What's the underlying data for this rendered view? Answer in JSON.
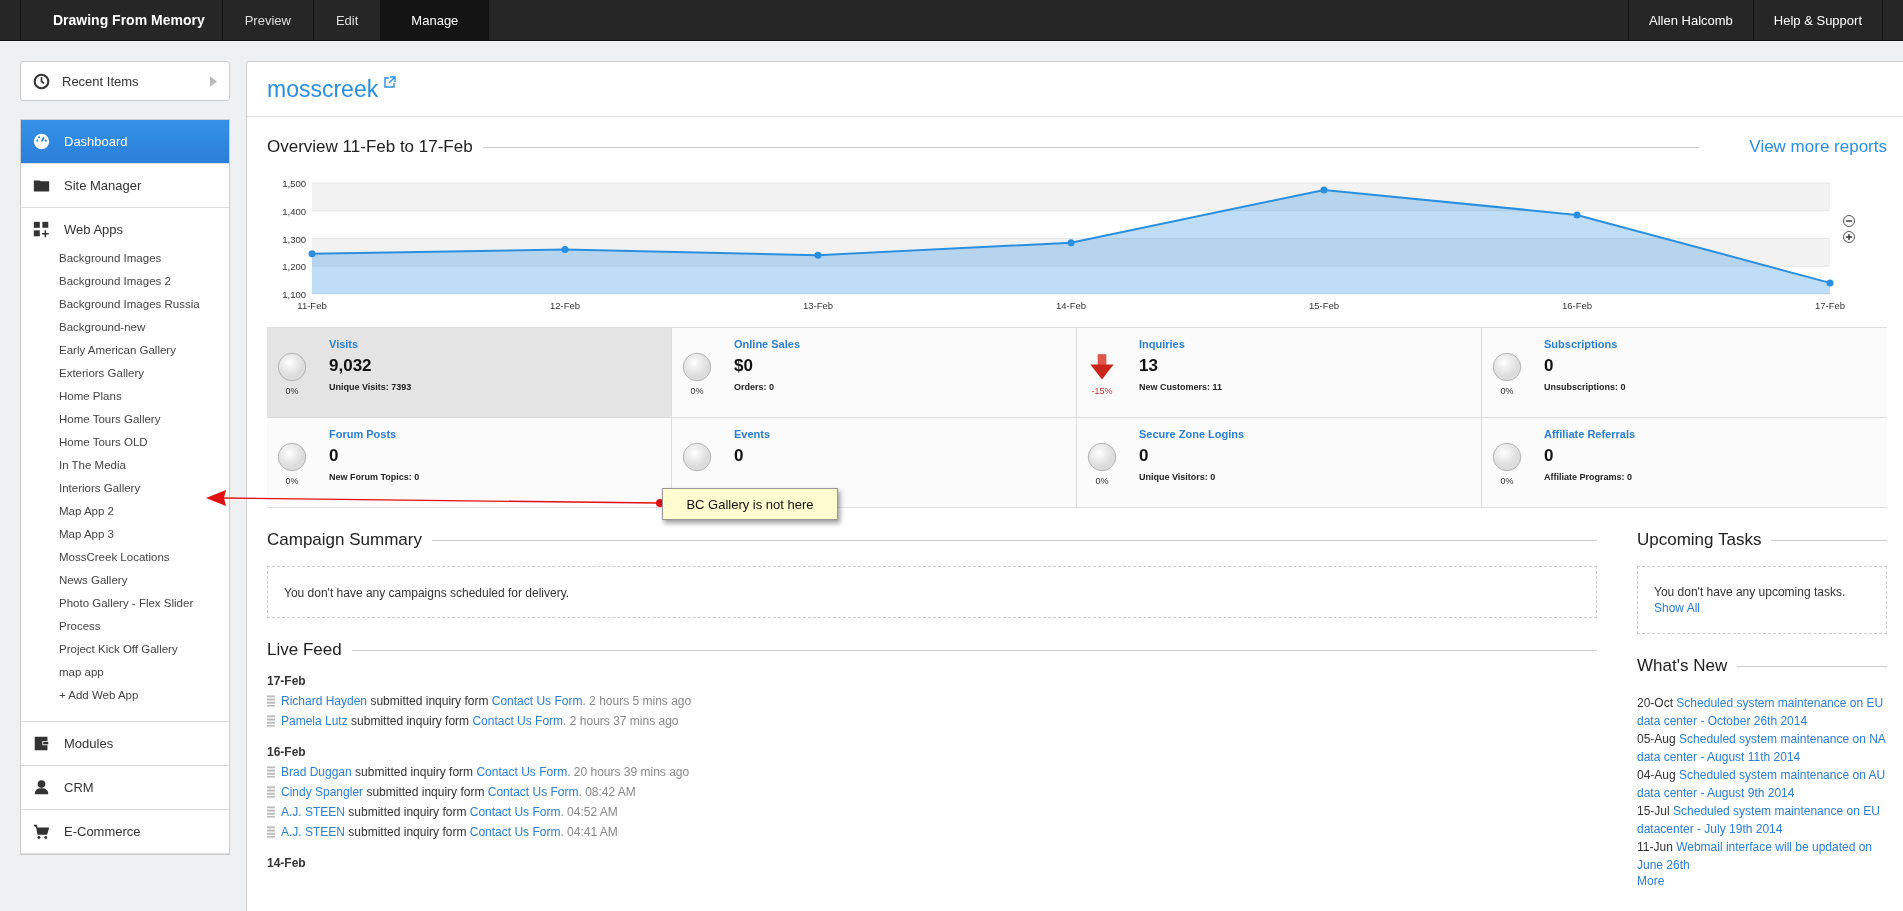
{
  "topbar": {
    "brand": "Drawing From Memory",
    "tabs": [
      {
        "label": "Preview",
        "selected": false
      },
      {
        "label": "Edit",
        "selected": false
      },
      {
        "label": "Manage",
        "selected": true
      }
    ],
    "right_links": [
      "Allen Halcomb",
      "Help & Support"
    ]
  },
  "sidebar": {
    "recent": "Recent Items",
    "items": [
      {
        "label": "Dashboard",
        "selected": true
      },
      {
        "label": "Site Manager",
        "selected": false
      },
      {
        "label": "Web Apps",
        "selected": false,
        "expanded": true,
        "children": [
          {
            "label": "Background Images"
          },
          {
            "label": "Background Images 2"
          },
          {
            "label": "Background Images Russia"
          },
          {
            "label": "Background-new"
          },
          {
            "label": "Early American Gallery"
          },
          {
            "label": "Exteriors Gallery"
          },
          {
            "label": "Home Plans"
          },
          {
            "label": "Home Tours Gallery"
          },
          {
            "label": "Home Tours OLD"
          },
          {
            "label": "In The Media"
          },
          {
            "label": "Interiors Gallery"
          },
          {
            "label": "Map App 2"
          },
          {
            "label": "Map App 3"
          },
          {
            "label": "MossCreek Locations"
          },
          {
            "label": "News Gallery"
          },
          {
            "label": "Photo Gallery - Flex Slider"
          },
          {
            "label": "Process"
          },
          {
            "label": "Project Kick Off Gallery"
          },
          {
            "label": "map app"
          }
        ],
        "add_link": "+ Add Web App"
      },
      {
        "label": "Modules",
        "selected": false
      },
      {
        "label": "CRM",
        "selected": false
      },
      {
        "label": "E-Commerce",
        "selected": false
      }
    ]
  },
  "site": {
    "name": "mosscreek"
  },
  "overview": {
    "title": "Overview 11-Feb to 17-Feb",
    "link": "View more reports",
    "chart_data": {
      "type": "area",
      "categories": [
        "11-Feb",
        "12-Feb",
        "13-Feb",
        "14-Feb",
        "15-Feb",
        "16-Feb",
        "17-Feb"
      ],
      "grid": true,
      "series": [
        {
          "color": "#2b8fe0",
          "values": [
            1245,
            1260,
            1240,
            1285,
            1475,
            1385,
            1140
          ]
        }
      ],
      "ylim": [
        1100,
        1500
      ],
      "yticks": [
        {
          "value": 1100,
          "label": "1,100"
        },
        {
          "value": 1200,
          "label": "1,200"
        },
        {
          "value": 1300,
          "label": "1,300"
        },
        {
          "value": 1400,
          "label": "1,400"
        },
        {
          "value": 1500,
          "label": "1,500"
        }
      ]
    }
  },
  "stats": [
    {
      "title": "Visits",
      "value": "9,032",
      "kind": "circle",
      "percent": "0%",
      "sub": "Unique Visits: 7393",
      "selected": true
    },
    {
      "title": "Online Sales",
      "value": "$0",
      "kind": "circle",
      "percent": "0%",
      "sub": "Orders: 0",
      "selected": false
    },
    {
      "title": "Inquiries",
      "value": "13",
      "kind": "down",
      "percent": "-15%",
      "sub": "New Customers: 11",
      "selected": false
    },
    {
      "title": "Subscriptions",
      "value": "0",
      "kind": "circle",
      "percent": "0%",
      "sub": "Unsubscriptions: 0",
      "selected": false
    },
    {
      "title": "Forum Posts",
      "value": "0",
      "kind": "circle",
      "percent": "0%",
      "sub": "New Forum Topics: 0",
      "selected": false
    },
    {
      "title": "Events",
      "value": "0",
      "kind": "circle",
      "selected": false
    },
    {
      "title": "Secure Zone Logins",
      "value": "0",
      "kind": "circle",
      "percent": "0%",
      "sub": "Unique Visitors: 0",
      "selected": false
    },
    {
      "title": "Affiliate Referrals",
      "value": "0",
      "kind": "circle",
      "percent": "0%",
      "sub": "Affiliate Programs: 0",
      "selected": false
    }
  ],
  "callout": {
    "text": "BC Gallery is not here"
  },
  "campaign": {
    "title": "Campaign Summary",
    "empty": "You don't have any campaigns scheduled for delivery."
  },
  "live_feed": {
    "title": "Live Feed",
    "groups": [
      {
        "date": "17-Feb",
        "entries": [
          {
            "name": "Richard Hayden",
            "action": "submitted inquiry form",
            "form": "Contact Us Form",
            "time": ". 2 hours 5 mins ago"
          },
          {
            "name": "Pamela Lutz",
            "action": "submitted inquiry form",
            "form": "Contact Us Form",
            "time": ". 2 hours 37 mins ago"
          }
        ]
      },
      {
        "date": "16-Feb",
        "entries": [
          {
            "name": "Brad Duggan",
            "action": "submitted inquiry form",
            "form": "Contact Us Form",
            "time": ". 20 hours 39 mins ago"
          },
          {
            "name": "Cindy Spangler",
            "action": "submitted inquiry form",
            "form": "Contact Us Form",
            "time": ". 08:42 AM"
          },
          {
            "name": "A.J. STEEN",
            "action": "submitted inquiry form",
            "form": "Contact Us Form",
            "time": ". 04:52 AM"
          },
          {
            "name": "A.J. STEEN",
            "action": "submitted inquiry form",
            "form": "Contact Us Form",
            "time": ". 04:41 AM"
          }
        ]
      },
      {
        "date": "14-Feb"
      }
    ]
  },
  "tasks": {
    "title": "Upcoming Tasks",
    "empty": "You don't have any upcoming tasks.",
    "link": "Show All"
  },
  "whats_new": {
    "title": "What's New",
    "items": [
      {
        "date": "20-Oct",
        "text": "Scheduled system maintenance on EU data center - October 26th 2014"
      },
      {
        "date": "05-Aug",
        "text": "Scheduled system maintenance on NA data center - August 11th 2014"
      },
      {
        "date": "04-Aug",
        "text": "Scheduled system maintenance on AU data center - August 9th 2014"
      },
      {
        "date": "15-Jul",
        "text": "Scheduled system maintenance on EU datacenter - July 19th 2014"
      },
      {
        "date": "11-Jun",
        "text": "Webmail interface will be updated on June 26th"
      }
    ],
    "more": "More"
  }
}
